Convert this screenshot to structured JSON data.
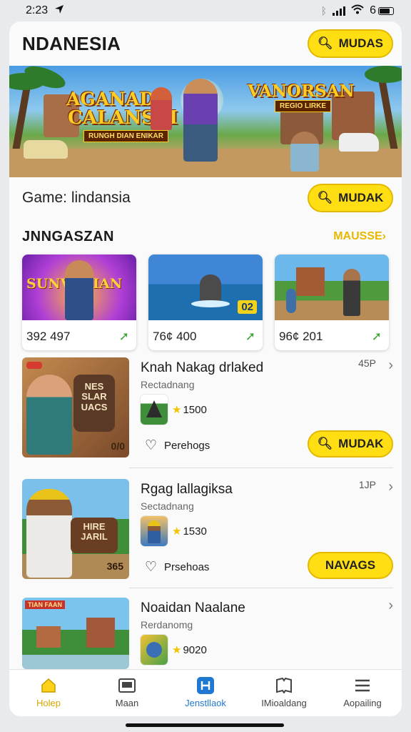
{
  "status": {
    "time": "2:23",
    "battery": "6"
  },
  "header": {
    "title": "NDANESIA",
    "button_label": "MUDAS"
  },
  "banner": {
    "logo_left_line1": "AGANAD",
    "logo_left_line2": "CALANSAI",
    "logo_left_sub": "RUNGH DIAN ENIKAR",
    "logo_right": "VANORSAN",
    "logo_right_sub": "REGIO LIRKE"
  },
  "search": {
    "text": "Game: lindansia",
    "button_label": "MUDAK"
  },
  "section": {
    "title": "JNNGASZAN",
    "more_label": "MAUSSE›"
  },
  "cards": [
    {
      "count": "392 497",
      "thumb_text": "SUNVEGIAN"
    },
    {
      "count": "76¢ 400",
      "thumb_badge": "02"
    },
    {
      "count": "96¢ 201"
    }
  ],
  "list": [
    {
      "title": "Knah Nakag drlaked",
      "subtitle": "Rectadnang",
      "side": "45P",
      "rating": "1500",
      "fav_label": "Perehogs",
      "button_label": "MUDAK",
      "thumb_text": "NES SLAR UACS",
      "thumb_badge": "0/0"
    },
    {
      "title": "Rgag lallagiksa",
      "subtitle": "Sectadnang",
      "side": "1JP",
      "rating": "1530",
      "fav_label": "Prsehoas",
      "button_label": "NAVAGS",
      "thumb_text": "HIRE JARIL",
      "thumb_badge": "365"
    },
    {
      "title": "Noaidan Naalane",
      "subtitle": "Rerdanomg",
      "rating": "9020",
      "thumb_badge": "TIAN FAAN"
    }
  ],
  "tabs": [
    {
      "label": "Holep",
      "icon": "home-icon"
    },
    {
      "label": "Maan",
      "icon": "image-icon"
    },
    {
      "label": "Jenstllaok",
      "icon": "app-icon"
    },
    {
      "label": "IMioaldang",
      "icon": "book-icon"
    },
    {
      "label": "Aopailing",
      "icon": "menu-icon"
    }
  ],
  "colors": {
    "accent": "#ffdf14",
    "accent_border": "#e3b800",
    "active_tab": "#1f78d1",
    "arrow_green": "#3ea437"
  }
}
